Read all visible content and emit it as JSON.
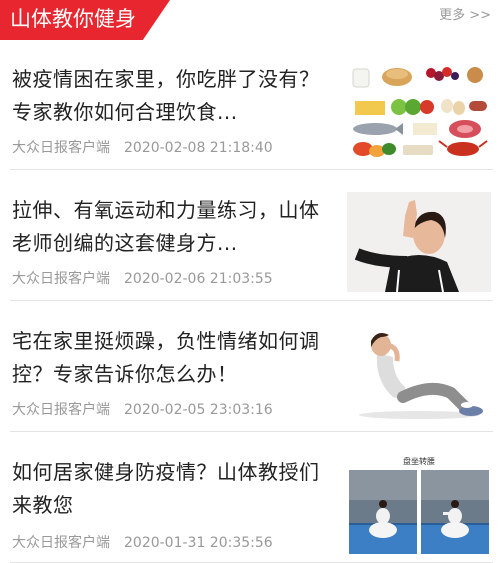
{
  "header": {
    "title": "山体教你健身",
    "more_label": "更多 >>"
  },
  "colors": {
    "accent": "#e8262f",
    "meta": "#999999",
    "title": "#222222",
    "divider": "#e4e4e4"
  },
  "articles": [
    {
      "title": "被疫情困在家里，你吃胖了没有？专家教你如何合理饮食...",
      "source": "大众日报客户端",
      "date": "2020-02-08 21:18:40",
      "thumbnail_icon": "food-assortment-image"
    },
    {
      "title": "拉伸、有氧运动和力量练习，山体老师创编的这套健身方...",
      "source": "大众日报客户端",
      "date": "2020-02-06 21:03:55",
      "thumbnail_icon": "stretching-woman-image"
    },
    {
      "title": "宅在家里挺烦躁，负性情绪如何调控？专家告诉你怎么办！",
      "source": "大众日报客户端",
      "date": "2020-02-05 23:03:16",
      "thumbnail_icon": "situp-woman-image"
    },
    {
      "title": "如何居家健身防疫情？山体教授们来教您",
      "source": "大众日报客户端",
      "date": "2020-01-31 20:35:56",
      "thumbnail_icon": "gym-exercise-image",
      "thumbnail_caption": "盘坐转腰"
    }
  ]
}
